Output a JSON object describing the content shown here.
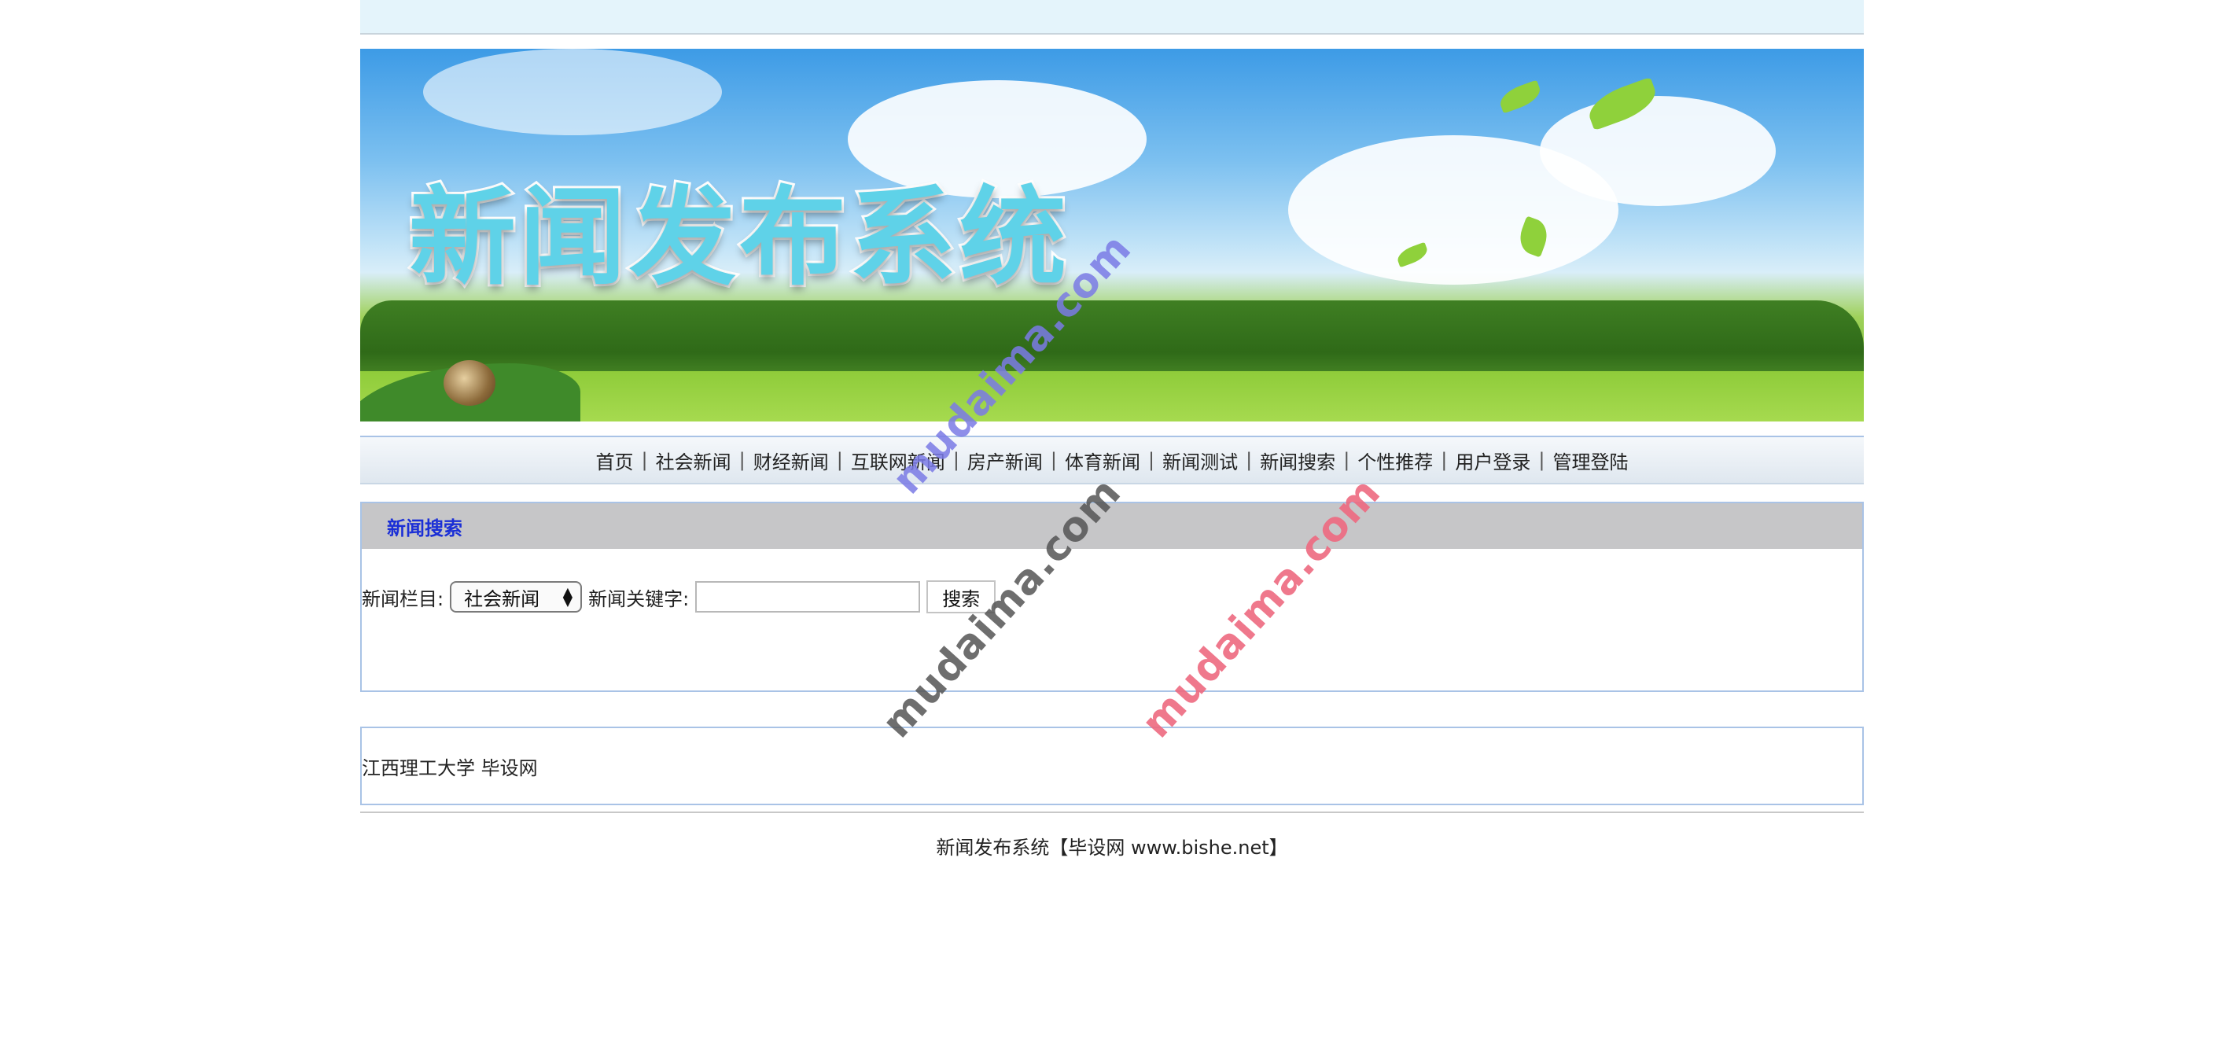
{
  "banner": {
    "title": "新闻发布系统"
  },
  "nav": {
    "items": [
      "首页",
      "社会新闻",
      "财经新闻",
      "互联网新闻",
      "房产新闻",
      "体育新闻",
      "新闻测试",
      "新闻搜索",
      "个性推荐",
      "用户登录",
      "管理登陆"
    ],
    "separator": "|"
  },
  "search": {
    "header": "新闻搜索",
    "category_label": "新闻栏目:",
    "category_value": "社会新闻",
    "keyword_label": "新闻关键字:",
    "keyword_value": "",
    "button": "搜索"
  },
  "footer": {
    "school": "江西理工大学 毕设网",
    "copyright": "新闻发布系统【毕设网 www.bishe.net】"
  },
  "watermark": {
    "text": "mudaima.com"
  },
  "colors": {
    "nav_border": "#a9c3e6",
    "search_header_bg": "#c6c6c8",
    "search_header_text": "#1b2fd6",
    "topbar_bg": "#e4f4fb",
    "watermark_blue": "#7b7be6",
    "watermark_gray": "#555555",
    "watermark_red": "#ee6a80"
  }
}
